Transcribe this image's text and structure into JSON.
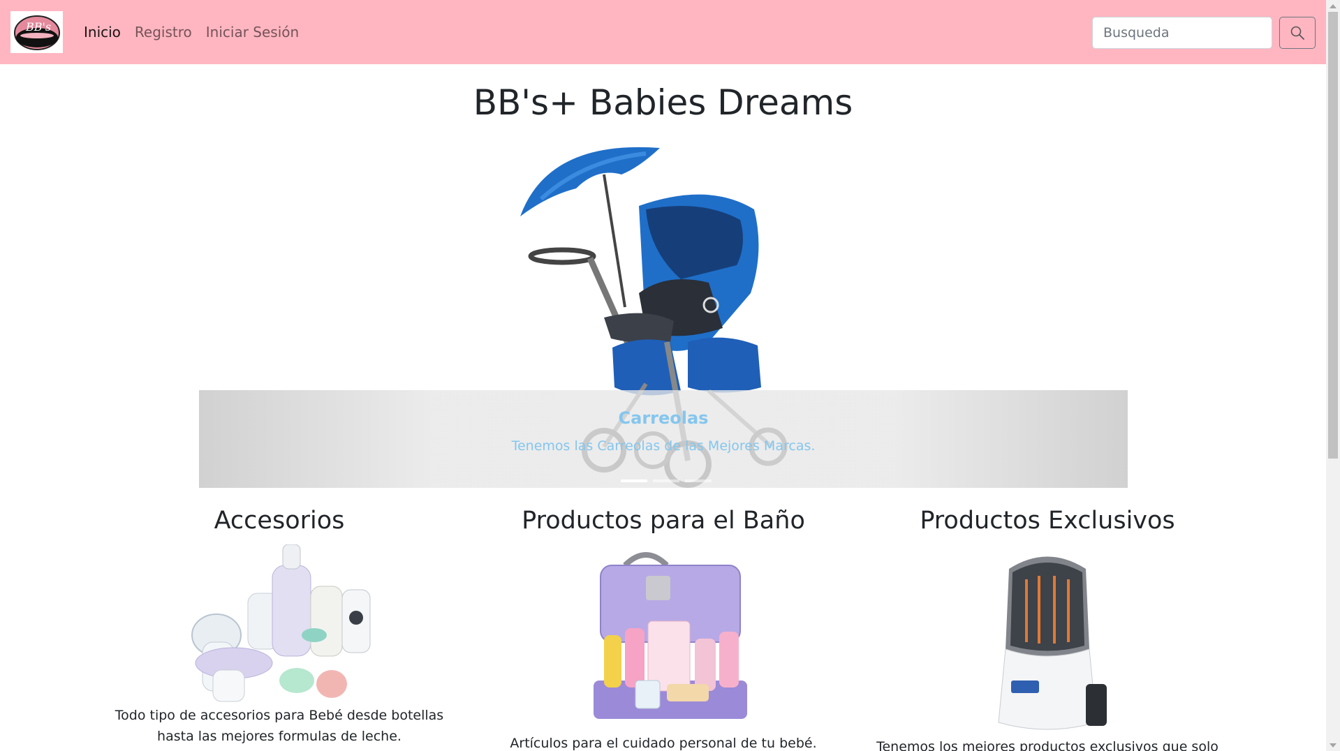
{
  "navbar": {
    "brand_text": "BB's",
    "links": [
      {
        "label": "Inicio",
        "active": true
      },
      {
        "label": "Registro",
        "active": false
      },
      {
        "label": "Iniciar Sesión",
        "active": false
      }
    ],
    "search_placeholder": "Busqueda",
    "search_icon": "search-icon",
    "bg_color": "#ffb6c1"
  },
  "hero": {
    "title": "BB's+ Babies Dreams",
    "slide": {
      "caption_title": "Carreolas",
      "caption_text": "Tenemos las Carreolas de las Mejores Marcas."
    },
    "indicator_count": 3,
    "active_indicator": 0
  },
  "cards": [
    {
      "title": "Accesorios",
      "text": "Todo tipo de accesorios para Bebé desde botellas hasta las mejores formulas de leche."
    },
    {
      "title": "Productos para el Baño",
      "text": "Artículos para el cuidado personal de tu bebé."
    },
    {
      "title": "Productos Exclusivos",
      "text": "Tenemos los mejores productos exclusivos que solo aquí"
    }
  ],
  "colors": {
    "caption": "#84c6ee",
    "stroller_blue": "#1f6fc9"
  }
}
